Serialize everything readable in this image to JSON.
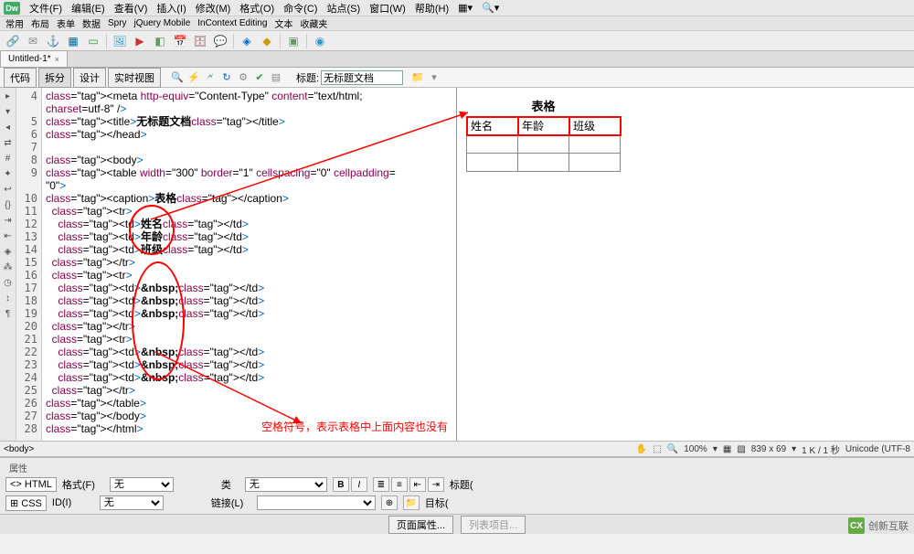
{
  "menu": {
    "file": "文件(F)",
    "edit": "编辑(E)",
    "view": "查看(V)",
    "insert": "插入(I)",
    "modify": "修改(M)",
    "format": "格式(O)",
    "commands": "命令(C)",
    "site": "站点(S)",
    "window": "窗口(W)",
    "help": "帮助(H)"
  },
  "logo": "Dw",
  "subtabs": [
    "常用",
    "布局",
    "表单",
    "数据",
    "Spry",
    "jQuery Mobile",
    "InContext Editing",
    "文本",
    "收藏夹"
  ],
  "tab": {
    "name": "Untitled-1*",
    "close": "×"
  },
  "view": {
    "code": "代码",
    "split": "拆分",
    "design": "设计",
    "live": "实时视图",
    "title_lbl": "标题:",
    "title_val": "无标题文档"
  },
  "lines": [
    "4",
    "",
    "5",
    "6",
    "7",
    "8",
    "9",
    "",
    "10",
    "11",
    "12",
    "13",
    "14",
    "15",
    "16",
    "17",
    "18",
    "19",
    "20",
    "21",
    "22",
    "23",
    "24",
    "25",
    "26",
    "27",
    "28",
    ""
  ],
  "code_lines": [
    "<meta http-equiv=\"Content-Type\" content=\"text/html;",
    "charset=utf-8\" />",
    "<title>无标题文档</title>",
    "</head>",
    "",
    "<body>",
    "<table width=\"300\" border=\"1\" cellspacing=\"0\" cellpadding=",
    "\"0\">",
    "<caption>表格</caption>",
    "  <tr>",
    "    <td>姓名</td>",
    "    <td>年龄</td>",
    "    <td>班级</td>",
    "  </tr>",
    "  <tr>",
    "    <td>&nbsp;</td>",
    "    <td>&nbsp;</td>",
    "    <td>&nbsp;</td>",
    "  </tr>",
    "  <tr>",
    "    <td>&nbsp;</td>",
    "    <td>&nbsp;</td>",
    "    <td>&nbsp;</td>",
    "  </tr>",
    "</table>",
    "</body>",
    "</html>",
    ""
  ],
  "preview": {
    "caption": "表格",
    "h1": "姓名",
    "h2": "年龄",
    "h3": "班级"
  },
  "annot": "空格符号，表示表格中上面内容也没有",
  "breadcrumb": {
    "path": "<body>",
    "zoom": "100%",
    "dims": "839 x 69",
    "size": "1 K / 1 秒",
    "enc": "Unicode (UTF-8"
  },
  "props": {
    "title": "属性",
    "html": "<> HTML",
    "css": "⊞ CSS",
    "format_lbl": "格式(F)",
    "format_val": "无",
    "class_lbl": "类",
    "class_val": "无",
    "id_lbl": "ID(I)",
    "id_val": "无",
    "link_lbl": "链接(L)",
    "title2_lbl": "标题(",
    "target_lbl": "目标("
  },
  "bottom": {
    "pageprops": "页面属性...",
    "listitems": "列表项目..."
  },
  "corner": "创新互联"
}
